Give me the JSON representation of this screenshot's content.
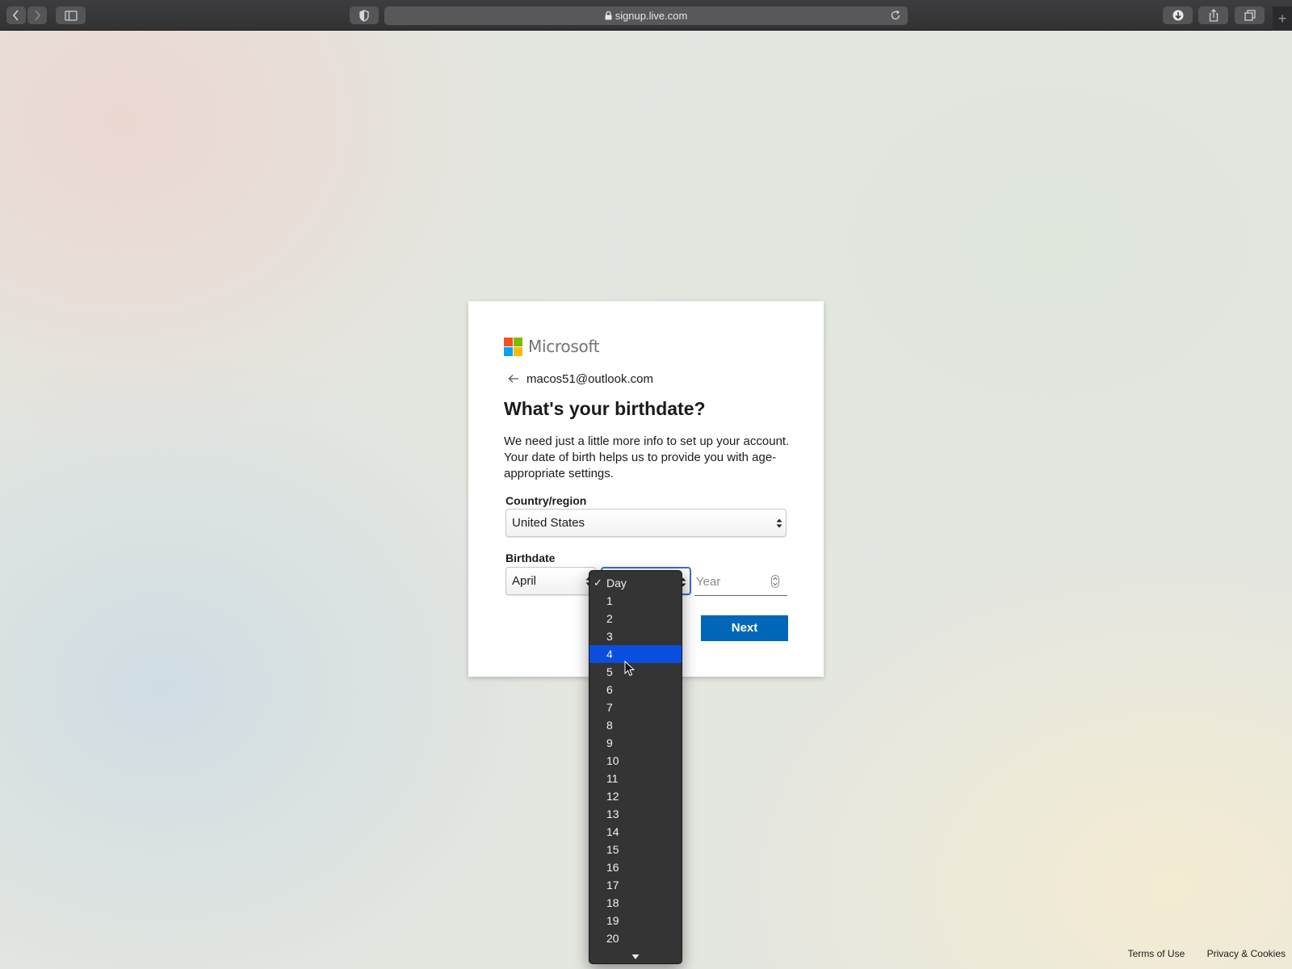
{
  "browser": {
    "url": "signup.live.com"
  },
  "brand": {
    "name": "Microsoft",
    "colors": [
      "#f25022",
      "#7fba00",
      "#00a4ef",
      "#ffb900"
    ]
  },
  "identity": {
    "email": "macos51@outlook.com"
  },
  "page": {
    "title": "What's your birthdate?",
    "description": "We need just a little more info to set up your account. Your date of birth helps us to provide you with age-appropriate settings."
  },
  "country": {
    "label": "Country/region",
    "value": "United States"
  },
  "birthdate": {
    "label": "Birthdate",
    "month_value": "April",
    "year_placeholder": "Year"
  },
  "next_label": "Next",
  "day_dropdown": {
    "checked": "Day",
    "highlighted": "4",
    "options": [
      "Day",
      "1",
      "2",
      "3",
      "4",
      "5",
      "6",
      "7",
      "8",
      "9",
      "10",
      "11",
      "12",
      "13",
      "14",
      "15",
      "16",
      "17",
      "18",
      "19",
      "20"
    ]
  },
  "footer": {
    "terms": "Terms of Use",
    "privacy": "Privacy & Cookies"
  },
  "accent_color": "#0067b8"
}
